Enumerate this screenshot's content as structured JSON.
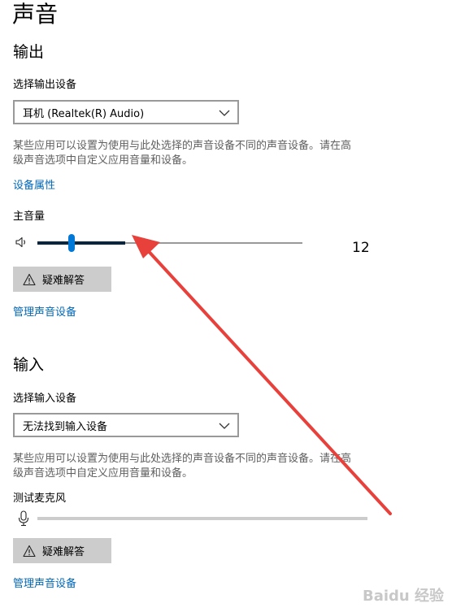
{
  "page": {
    "title": "声音"
  },
  "output": {
    "section_title": "输出",
    "device_label": "选择输出设备",
    "device_selected": "耳机 (Realtek(R) Audio)",
    "description_line1": "某些应用可以设置为使用与此处选择的声音设备不同的声音设备。请在高",
    "description_line2": "级声音选项中自定义应用音量和设备。",
    "properties_link": "设备属性",
    "volume_label": "主音量",
    "volume_value": "12",
    "volume_level_percent": 12,
    "troubleshoot_label": "疑难解答",
    "manage_link": "管理声音设备"
  },
  "input": {
    "section_title": "输入",
    "device_label": "选择输入设备",
    "device_selected": "无法找到输入设备",
    "description_line1": "某些应用可以设置为使用与此处选择的声音设备不同的声音设备。请在高",
    "description_line2": "级声音选项中自定义应用音量和设备。",
    "mic_test_label": "测试麦克风",
    "troubleshoot_label": "疑难解答",
    "manage_link": "管理声音设备"
  },
  "icons": {
    "speaker": "speaker-icon",
    "microphone": "microphone-icon",
    "warning": "warning-icon",
    "chevron": "chevron-down-icon"
  },
  "colors": {
    "accent": "#0078d7",
    "link": "#0067b8",
    "annotation_arrow": "#e8413c"
  },
  "watermark": "Baidu 经验"
}
